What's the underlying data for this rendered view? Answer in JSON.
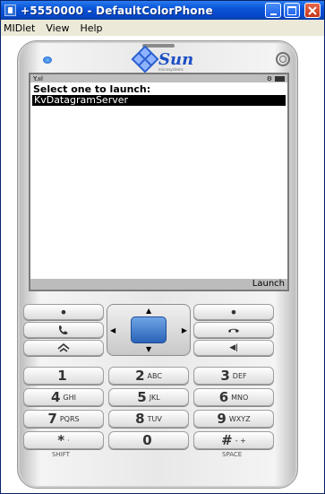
{
  "window": {
    "title": "+5550000 - DefaultColorPhone"
  },
  "menu": {
    "items": [
      "MIDlet",
      "View",
      "Help"
    ]
  },
  "phone": {
    "brand": "Sun",
    "brand_sub": "microsystems",
    "screen": {
      "status_signal": "Y.ııl",
      "heading": "Select one to launch:",
      "selected_item": "KvDatagramServer",
      "softkey_right": "Launch"
    },
    "keys": {
      "left_soft": "•",
      "right_soft": "•",
      "call": "call",
      "end": "end",
      "home": "home",
      "clear": "clear",
      "k1": {
        "num": "1",
        "let": ""
      },
      "k2": {
        "num": "2",
        "let": "ABC"
      },
      "k3": {
        "num": "3",
        "let": "DEF"
      },
      "k4": {
        "num": "4",
        "let": "GHI"
      },
      "k5": {
        "num": "5",
        "let": "JKL"
      },
      "k6": {
        "num": "6",
        "let": "MNO"
      },
      "k7": {
        "num": "7",
        "let": "PQRS"
      },
      "k8": {
        "num": "8",
        "let": "TUV"
      },
      "k9": {
        "num": "9",
        "let": "WXYZ"
      },
      "kstar": {
        "num": "*",
        "let": "·"
      },
      "k0": {
        "num": "0",
        "let": ""
      },
      "khash": {
        "num": "#",
        "let": "- +"
      },
      "shift": "SHIFT",
      "space": "SPACE"
    }
  }
}
